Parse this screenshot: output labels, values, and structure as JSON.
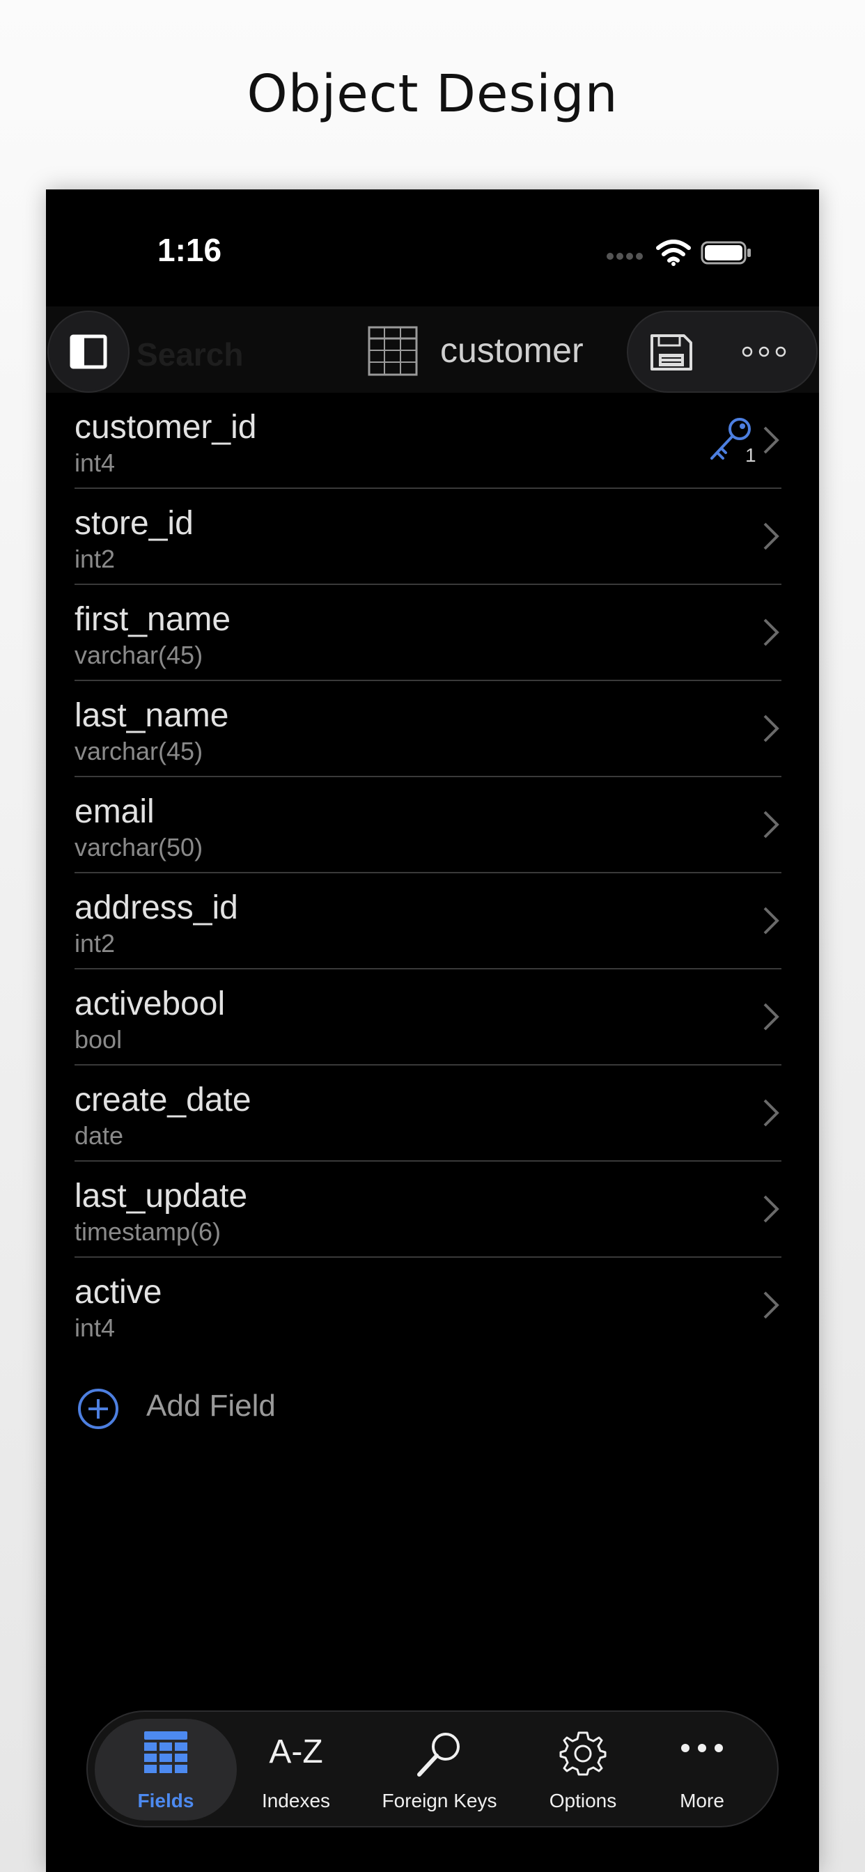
{
  "page_title": "Object Design",
  "status_bar": {
    "time": "1:16"
  },
  "navbar": {
    "search_placeholder": "Search",
    "table_title": "customer"
  },
  "fields": [
    {
      "name": "customer_id",
      "type": "int4",
      "primary_key_order": "1"
    },
    {
      "name": "store_id",
      "type": "int2"
    },
    {
      "name": "first_name",
      "type": "varchar(45)"
    },
    {
      "name": "last_name",
      "type": "varchar(45)"
    },
    {
      "name": "email",
      "type": "varchar(50)"
    },
    {
      "name": "address_id",
      "type": "int2"
    },
    {
      "name": "activebool",
      "type": "bool"
    },
    {
      "name": "create_date",
      "type": "date"
    },
    {
      "name": "last_update",
      "type": "timestamp(6)"
    },
    {
      "name": "active",
      "type": "int4"
    }
  ],
  "add_field_label": "Add Field",
  "tabs": {
    "fields": "Fields",
    "indexes": "Indexes",
    "indexes_icon_text": "A-Z",
    "foreign_keys": "Foreign Keys",
    "options": "Options",
    "more": "More",
    "active": "fields"
  },
  "colors": {
    "accent": "#4d8af0",
    "background": "#000000",
    "separator": "#3a3a3a"
  },
  "icons": [
    "sidebar-toggle-icon",
    "table-grid-icon",
    "save-icon",
    "more-ellipsis-icon",
    "key-icon",
    "chevron-right-icon",
    "add-circle-icon",
    "fields-grid-icon",
    "foreign-key-search-icon",
    "options-gear-icon",
    "more-dots-icon",
    "wifi-icon",
    "battery-icon",
    "cellular-signal-icon"
  ]
}
